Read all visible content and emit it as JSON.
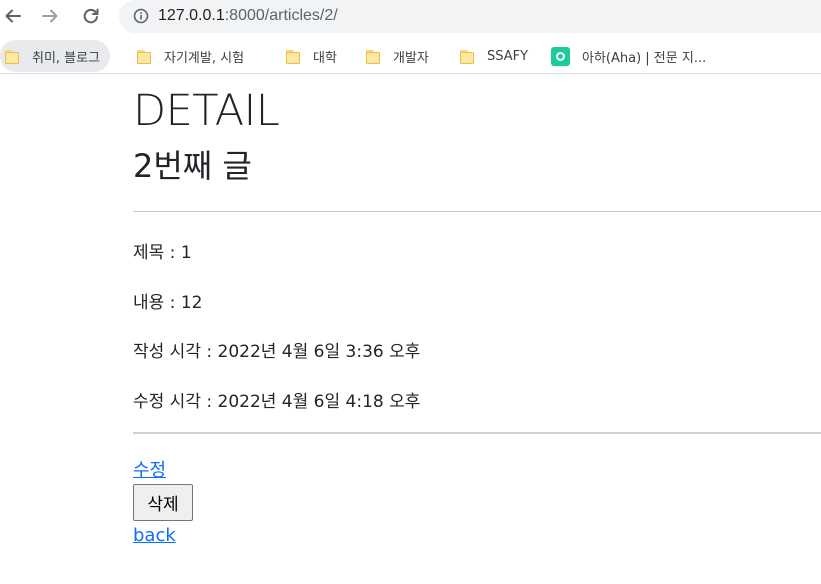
{
  "browser": {
    "url_host": "127.0.0.1",
    "url_rest": ":8000/articles/2/",
    "bookmarks": [
      {
        "label": "취미, 블로그",
        "icon": "folder-icon"
      },
      {
        "label": "자기계발, 시험",
        "icon": "folder-icon"
      },
      {
        "label": "대학",
        "icon": "folder-icon"
      },
      {
        "label": "개발자",
        "icon": "folder-icon"
      },
      {
        "label": "SSAFY",
        "icon": "folder-icon"
      },
      {
        "label": "아하(Aha) | 전문 지...",
        "icon": "aha-site-icon"
      }
    ]
  },
  "page": {
    "heading": "DETAIL",
    "subheading": "2번째 글",
    "fields": {
      "title": "제목 : 1",
      "content": "내용 : 12",
      "created": "작성 시각 : 2022년 4월 6일 3:36 오후",
      "updated": "수정 시각 : 2022년 4월 6일 4:18 오후"
    },
    "edit_link": "수정",
    "delete_button": "삭제",
    "back_link": "back"
  },
  "colors": {
    "link": "#0d6efd",
    "aha_brand": "#1ccb9c",
    "folder": "#fce8a2"
  }
}
